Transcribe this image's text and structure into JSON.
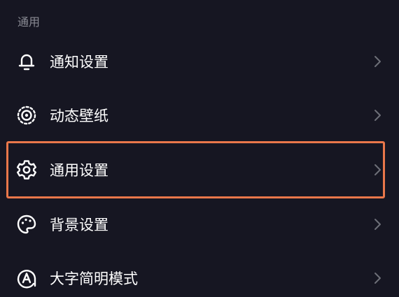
{
  "section": {
    "title": "通用"
  },
  "menu": {
    "items": [
      {
        "label": "通知设置",
        "icon": "bell-icon"
      },
      {
        "label": "动态壁纸",
        "icon": "live-wallpaper-icon"
      },
      {
        "label": "通用设置",
        "icon": "gear-icon"
      },
      {
        "label": "背景设置",
        "icon": "palette-icon"
      },
      {
        "label": "大字简明模式",
        "icon": "font-a-icon"
      }
    ]
  },
  "colors": {
    "background": "#161622",
    "text": "#ffffff",
    "section_header": "#8a8b94",
    "chevron": "#6e6f78",
    "highlight_border": "#e9774a"
  }
}
